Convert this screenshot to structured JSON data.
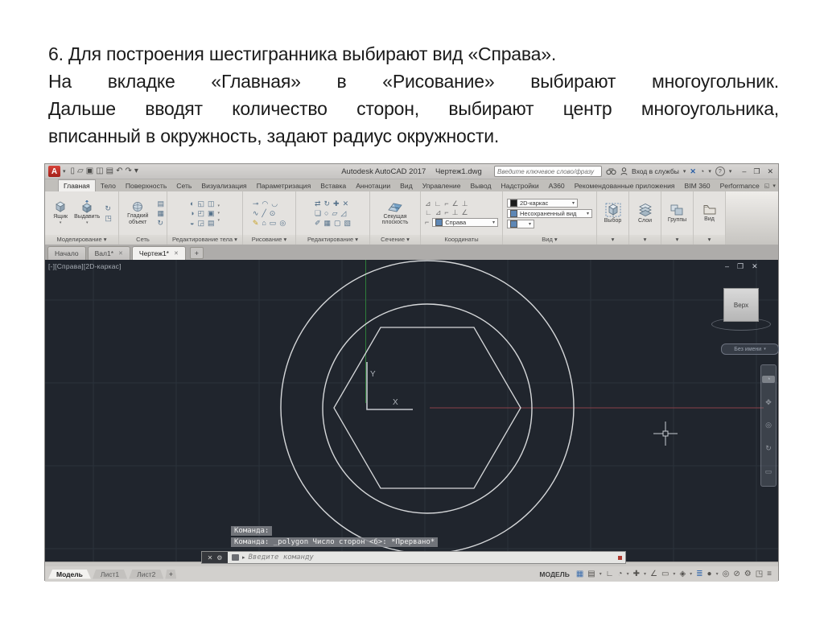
{
  "slide_text": {
    "lines": [
      {
        "text": "6. Для построения шестигранника выбирают вид «Справа».",
        "cls": ""
      },
      {
        "text": "На вкладке «Главная» в «Рисование» выбирают многоугольник.",
        "cls": "just"
      },
      {
        "text": "Дальше вводят количество сторон, выбирают центр многоугольника,",
        "cls": "just"
      },
      {
        "text": "вписанный в окружность, задают радиус окружности.",
        "cls": ""
      }
    ]
  },
  "icons": {
    "close": "✕",
    "minimize": "–",
    "restore": "❐",
    "dropdown": "▾",
    "plus": "+",
    "help": "?",
    "prompt_arrow": "▸"
  },
  "titlebar": {
    "logo_letter": "A",
    "qat_icons": [
      {
        "name": "new-file-icon",
        "g": "▯"
      },
      {
        "name": "open-file-icon",
        "g": "▱"
      },
      {
        "name": "save-icon",
        "g": "▣"
      },
      {
        "name": "save-as-icon",
        "g": "◫"
      },
      {
        "name": "plot-icon",
        "g": "▤"
      },
      {
        "name": "undo-icon",
        "g": "↶"
      },
      {
        "name": "redo-icon",
        "g": "↷"
      },
      {
        "name": "qat-customize-icon",
        "g": "▾"
      }
    ],
    "app_title": "Autodesk AutoCAD 2017",
    "doc_title": "Чертеж1.dwg",
    "search_placeholder": "Введите ключевое слово/фразу",
    "signin_label": "Вход в службы"
  },
  "ribbon": {
    "tabs": [
      {
        "label": "Главная",
        "cls": "active"
      },
      {
        "label": "Тело",
        "cls": ""
      },
      {
        "label": "Поверхность",
        "cls": ""
      },
      {
        "label": "Сеть",
        "cls": ""
      },
      {
        "label": "Визуализация",
        "cls": ""
      },
      {
        "label": "Параметризация",
        "cls": ""
      },
      {
        "label": "Вставка",
        "cls": ""
      },
      {
        "label": "Аннотации",
        "cls": ""
      },
      {
        "label": "Вид",
        "cls": ""
      },
      {
        "label": "Управление",
        "cls": ""
      },
      {
        "label": "Вывод",
        "cls": ""
      },
      {
        "label": "Надстройки",
        "cls": ""
      },
      {
        "label": "A360",
        "cls": ""
      },
      {
        "label": "Рекомендованные приложения",
        "cls": ""
      },
      {
        "label": "BIM 360",
        "cls": ""
      },
      {
        "label": "Performance",
        "cls": ""
      }
    ],
    "panels": {
      "modeling": {
        "label": "Моделирование ▾",
        "btn_box": "Ящик",
        "btn_extrude": "Выдавить"
      },
      "mesh": {
        "label": "Сеть",
        "btn_smooth": "Гладкий объект"
      },
      "solid_editing": {
        "label": "Редактирование тела ▾"
      },
      "draw": {
        "label": "Рисование ▾"
      },
      "modify": {
        "label": "Редактирование ▾"
      },
      "section": {
        "label": "Сечение ▾",
        "btn_plane": "Секущая плоскость"
      },
      "coordinates": {
        "label": "Координаты",
        "view_value": "Справа"
      },
      "view": {
        "label": "Вид ▾",
        "visual_style": "2D-каркас",
        "named_view": "Несохраненный вид"
      },
      "selection": {
        "btn": "Выбор"
      },
      "layers": {
        "btn": "Слои"
      },
      "groups": {
        "btn": "Группы"
      },
      "view_tools": {
        "btn": "Вид"
      }
    },
    "icon_grids": {
      "modeling_side": [
        {
          "name": "presspull-icon",
          "g": "↻"
        },
        {
          "name": "revolve-icon",
          "g": "◳"
        }
      ],
      "mesh_side": [
        {
          "name": "mesh-refine-icon",
          "g": "▤"
        },
        {
          "name": "mesh-add-icon",
          "g": "▦"
        },
        {
          "name": "mesh-convert-icon",
          "g": "↻"
        }
      ],
      "solid_row1": [
        {
          "name": "union-icon",
          "g": "◐"
        },
        {
          "name": "subtract-icon",
          "g": "◱"
        },
        {
          "name": "intersect-icon",
          "g": "◫"
        }
      ],
      "solid_row2": [
        {
          "name": "slice-icon",
          "g": "◑"
        },
        {
          "name": "thicken-icon",
          "g": "◰"
        },
        {
          "name": "interfere-icon",
          "g": "▣"
        }
      ],
      "solid_row3": [
        {
          "name": "shell-icon",
          "g": "◒"
        },
        {
          "name": "imprint-icon",
          "g": "◲"
        },
        {
          "name": "check-icon",
          "g": "▤"
        }
      ],
      "draw_row1": [
        {
          "name": "polyline-icon",
          "g": "⊸"
        },
        {
          "name": "arc-icon",
          "g": "◠"
        },
        {
          "name": "arc2-icon",
          "g": "◡"
        }
      ],
      "draw_row2": [
        {
          "name": "spline-icon",
          "g": "∿"
        },
        {
          "name": "line-icon",
          "g": "╱"
        },
        {
          "name": "circle-icon",
          "g": "⊙"
        }
      ],
      "draw_row3": [
        {
          "name": "hatch-icon",
          "g": "✎",
          "cls": "warm"
        },
        {
          "name": "polygon-icon",
          "g": "⌂"
        },
        {
          "name": "rectangle-icon",
          "g": "▭"
        },
        {
          "name": "ellipse-icon",
          "g": "◎"
        }
      ],
      "modify_row1": [
        {
          "name": "move-icon",
          "g": "⇄"
        },
        {
          "name": "rotate-icon",
          "g": "↻"
        },
        {
          "name": "scale-icon",
          "g": "✚"
        },
        {
          "name": "erase-icon",
          "g": "✕"
        }
      ],
      "modify_row2": [
        {
          "name": "copy-icon",
          "g": "❏"
        },
        {
          "name": "offset-icon",
          "g": "○"
        },
        {
          "name": "mirror-icon",
          "g": "▱"
        },
        {
          "name": "fillet-icon",
          "g": "◿"
        }
      ],
      "modify_row3": [
        {
          "name": "trim-icon",
          "g": "✐"
        },
        {
          "name": "array-icon",
          "g": "▦"
        },
        {
          "name": "explode-icon",
          "g": "▢"
        },
        {
          "name": "stretch-icon",
          "g": "▧"
        }
      ],
      "coord_row1": [
        {
          "name": "ucs-icon",
          "g": "⊿"
        },
        {
          "name": "ucs-world-icon",
          "g": "∟"
        },
        {
          "name": "ucs-origin-icon",
          "g": "⌐"
        },
        {
          "name": "ucs-z-icon",
          "g": "∠"
        },
        {
          "name": "ucs-face-icon",
          "g": "⊥"
        }
      ],
      "coord_row2": [
        {
          "name": "ucs-named-icon",
          "g": "∟"
        },
        {
          "name": "ucs-object-icon",
          "g": "⊿"
        },
        {
          "name": "ucs-view-icon",
          "g": "⌐"
        },
        {
          "name": "ucs-xy-icon",
          "g": "⊥"
        },
        {
          "name": "ucs-rotate-icon",
          "g": "∠"
        }
      ],
      "navbar_icons": [
        {
          "name": "navwheel-icon",
          "g": "◔",
          "cls": "first"
        },
        {
          "name": "pan-icon",
          "g": "✥"
        },
        {
          "name": "zoom-icon",
          "g": "◎"
        },
        {
          "name": "orbit-icon",
          "g": "↻"
        },
        {
          "name": "showmotion-icon",
          "g": "▭"
        }
      ]
    },
    "tabrow_end_icons": [
      {
        "name": "ribbon-minimize-icon",
        "g": "◱"
      },
      {
        "name": "ribbon-cycle-icon",
        "g": "▾"
      }
    ]
  },
  "file_tabs": {
    "tabs": [
      {
        "label": "Начало",
        "cls": "noclose"
      },
      {
        "label": "Вал1*",
        "cls": ""
      },
      {
        "label": "Чертеж1*",
        "cls": "active"
      }
    ]
  },
  "viewport": {
    "label": "[-][Справа][2D-каркас]",
    "viewcube_face": "Верх",
    "ucs_pill": "Без имени",
    "axis_x": "X",
    "axis_y": "Y"
  },
  "command": {
    "history1": "Команда:",
    "history2": "Команда: _polygon Число сторон <6>: *Прервано*",
    "prompt_placeholder": "Введите команду"
  },
  "statusbar": {
    "layout_tabs": [
      {
        "label": "Модель",
        "cls": "active"
      },
      {
        "label": "Лист1",
        "cls": ""
      },
      {
        "label": "Лист2",
        "cls": ""
      }
    ],
    "model_label": "МОДЕЛЬ",
    "icons": [
      {
        "name": "grid-icon",
        "g": "▦",
        "cls": "blue"
      },
      {
        "name": "snap-mode-icon",
        "g": "▤",
        "cls": "dim"
      },
      {
        "name": "snap-dropdown-icon",
        "g": "▾",
        "cls": "chev"
      },
      {
        "name": "ortho-icon",
        "g": "∟",
        "cls": "dim"
      },
      {
        "name": "polar-tracking-icon",
        "g": "◔",
        "cls": "dim"
      },
      {
        "name": "polar-dropdown-icon",
        "g": "▾",
        "cls": "chev"
      },
      {
        "name": "isodraft-icon",
        "g": "✚",
        "cls": "dim"
      },
      {
        "name": "isodraft-dropdown-icon",
        "g": "▾",
        "cls": "chev"
      },
      {
        "name": "otrack-icon",
        "g": "∠",
        "cls": "dim"
      },
      {
        "name": "dynamic-input-icon",
        "g": "▭",
        "cls": "dim"
      },
      {
        "name": "dyn-dropdown-icon",
        "g": "▾",
        "cls": "chev"
      },
      {
        "name": "osnap-icon",
        "g": "◈",
        "cls": "dim"
      },
      {
        "name": "osnap-dropdown-icon",
        "g": "▾",
        "cls": "chev"
      },
      {
        "name": "lineweight-icon",
        "g": "≣",
        "cls": "blue"
      },
      {
        "name": "transparency-icon",
        "g": "●",
        "cls": "dim"
      },
      {
        "name": "transp-dropdown-icon",
        "g": "▾",
        "cls": "chev"
      },
      {
        "name": "selection-cycling-icon",
        "g": "◎",
        "cls": "dim"
      },
      {
        "name": "annotation-visibility-icon",
        "g": "⊘",
        "cls": "dim"
      },
      {
        "name": "workspace-icon",
        "g": "⚙",
        "cls": "dim"
      },
      {
        "name": "clean-screen-icon",
        "g": "◳",
        "cls": "dim"
      },
      {
        "name": "customize-statusbar-icon",
        "g": "≡",
        "cls": "dim"
      }
    ]
  }
}
